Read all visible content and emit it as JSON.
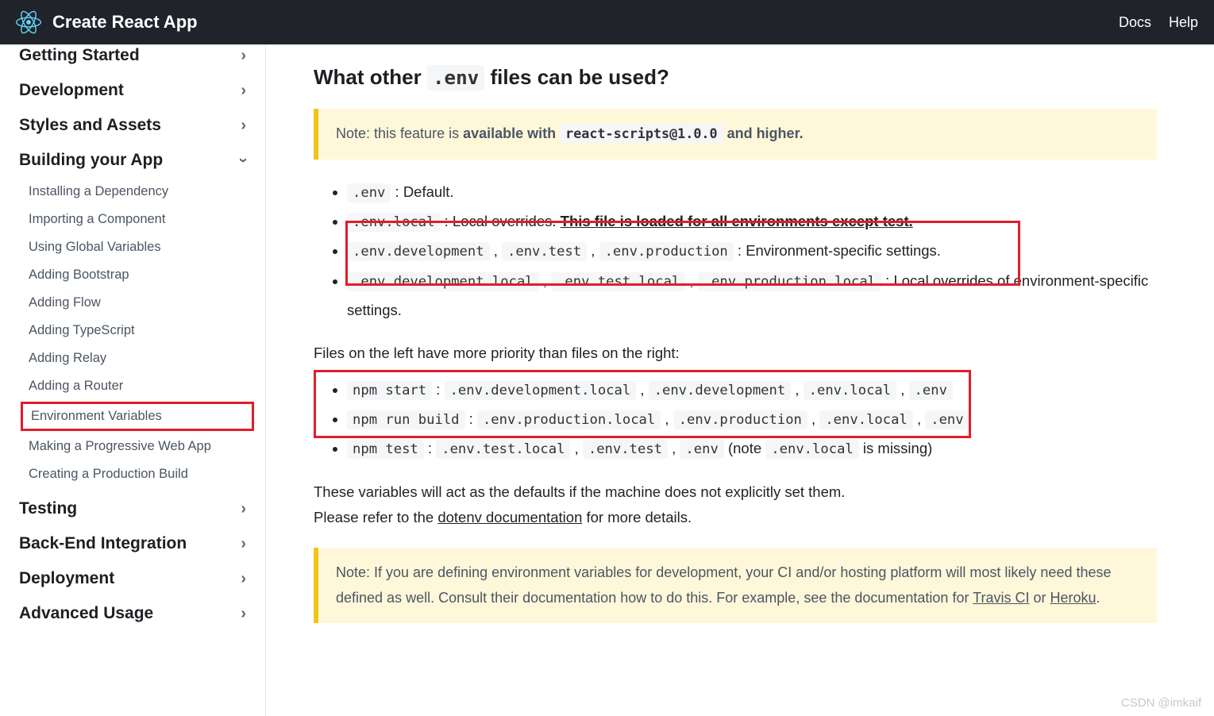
{
  "header": {
    "title": "Create React App",
    "nav": {
      "docs": "Docs",
      "help": "Help"
    }
  },
  "sidebar": {
    "cut_top": "Getting Started",
    "cat_dev": "Development",
    "cat_styles": "Styles and Assets",
    "cat_build": "Building your App",
    "build_items": {
      "i0": "Installing a Dependency",
      "i1": "Importing a Component",
      "i2": "Using Global Variables",
      "i3": "Adding Bootstrap",
      "i4": "Adding Flow",
      "i5": "Adding TypeScript",
      "i6": "Adding Relay",
      "i7": "Adding a Router",
      "i8": "Environment Variables",
      "i9": "Making a Progressive Web App",
      "i10": "Creating a Production Build"
    },
    "cat_testing": "Testing",
    "cat_backend": "Back-End Integration",
    "cat_deploy": "Deployment",
    "cat_adv": "Advanced Usage"
  },
  "content": {
    "heading_pre": "What other ",
    "heading_code": ".env",
    "heading_post": " files can be used?",
    "note1_pre": "Note: this feature is ",
    "note1_strong": "available with ",
    "note1_code": "react-scripts@1.0.0",
    "note1_post": " and higher.",
    "li1_code": ".env",
    "li1_text": " : Default.",
    "li2_code": ".env.local",
    "li2_text_a": " : Local overrides. ",
    "li2_text_b": "This file is loaded for all environments except test.",
    "li3_c1": ".env.development",
    "li3_c2": ".env.test",
    "li3_c3": ".env.production",
    "li3_text": " : Environment-specific settings.",
    "li4_c1": ".env.development.local",
    "li4_c2": ".env.test.local",
    "li4_c3": ".env.production.local",
    "li4_text": " : Local overrides of environment-specific settings.",
    "priority_para": "Files on the left have more priority than files on the right:",
    "p1_a": "npm start",
    "p1_b": ".env.development.local",
    "p1_c": ".env.development",
    "p1_d": ".env.local",
    "p1_e": ".env",
    "p2_a": "npm run build",
    "p2_b": ".env.production.local",
    "p2_c": ".env.production",
    "p2_d": ".env.local",
    "p2_e": ".env",
    "p3_a": "npm test",
    "p3_b": ".env.test.local",
    "p3_c": ".env.test",
    "p3_d": ".env",
    "p3_note_pre": " (note ",
    "p3_note_code": ".env.local",
    "p3_note_post": " is missing)",
    "defaults_para": "These variables will act as the defaults if the machine does not explicitly set them.",
    "refer_pre": "Please refer to the ",
    "refer_link": "dotenv documentation",
    "refer_post": " for more details.",
    "note2_a": "Note: If you are defining environment variables for development, your CI and/or hosting platform will most likely need these defined as well. Consult their documentation how to do this. For example, see the documentation for ",
    "note2_link1": "Travis CI",
    "note2_mid": " or ",
    "note2_link2": "Heroku",
    "note2_end": "."
  },
  "watermark": "CSDN @imkaif"
}
